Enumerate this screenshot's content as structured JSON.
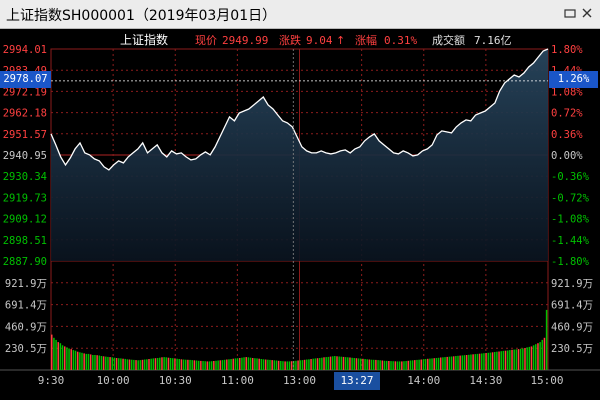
{
  "window": {
    "title": "上证指数SH000001（2019年03月01日）",
    "minimize_icon": "minimize-icon",
    "close_icon": "close-icon"
  },
  "colors": {
    "background": "#000000",
    "grid": "#8b1c1c",
    "up": "#ff4040",
    "down": "#00c000",
    "neutral": "#c8c8c8",
    "line": "#ffffff",
    "fill_top": "#27455c",
    "badge": "#1a56c8"
  },
  "info_bar": {
    "name": "上证指数",
    "price_label": "现价",
    "price": "2949.99",
    "change_label": "涨跌",
    "change": "9.04",
    "change_arrow": "↑",
    "pct_label": "涨幅",
    "pct": "0.31%",
    "turnover_label": "成交额",
    "turnover": "7.16亿"
  },
  "cursor": {
    "price": "2978.07",
    "pct": "1.26%",
    "time": "13:27"
  },
  "chart_data": {
    "type": "line",
    "prev_close": 2940.95,
    "ylim": [
      2887.9,
      2994.01
    ],
    "y_ticks_left": [
      "2994.01",
      "2983.49",
      "2972.19",
      "2962.18",
      "2951.57",
      "2940.95",
      "2930.34",
      "2919.73",
      "2909.12",
      "2898.51",
      "2887.90"
    ],
    "y_ticks_right": [
      "1.80%",
      "1.44%",
      "1.08%",
      "0.72%",
      "0.36%",
      "0.00%",
      "-0.36%",
      "-0.72%",
      "-1.08%",
      "-1.44%",
      "-1.80%"
    ],
    "x_ticks": [
      "9:30",
      "10:00",
      "10:30",
      "11:00",
      "13:00",
      "13:30",
      "14:00",
      "14:30",
      "15:00"
    ],
    "volume_ticks": [
      "921.9万",
      "691.4万",
      "460.9万",
      "230.5万"
    ],
    "volume_max": 921.9,
    "price_points": [
      [
        0,
        2951.5
      ],
      [
        3,
        2946
      ],
      [
        6,
        2940
      ],
      [
        9,
        2936
      ],
      [
        12,
        2939.5
      ],
      [
        15,
        2944
      ],
      [
        18,
        2947
      ],
      [
        21,
        2942
      ],
      [
        24,
        2941
      ],
      [
        27,
        2939
      ],
      [
        30,
        2938
      ],
      [
        33,
        2935
      ],
      [
        36,
        2933.5
      ],
      [
        39,
        2936
      ],
      [
        42,
        2938
      ],
      [
        45,
        2937
      ],
      [
        48,
        2940
      ],
      [
        51,
        2942
      ],
      [
        54,
        2944
      ],
      [
        57,
        2947
      ],
      [
        60,
        2942
      ],
      [
        63,
        2944
      ],
      [
        66,
        2946
      ],
      [
        69,
        2942
      ],
      [
        72,
        2940
      ],
      [
        75,
        2943
      ],
      [
        78,
        2941.5
      ],
      [
        81,
        2942
      ],
      [
        84,
        2940
      ],
      [
        87,
        2938.5
      ],
      [
        90,
        2939
      ],
      [
        93,
        2941
      ],
      [
        96,
        2942.5
      ],
      [
        99,
        2941
      ],
      [
        102,
        2945
      ],
      [
        105,
        2950
      ],
      [
        108,
        2955
      ],
      [
        111,
        2960
      ],
      [
        114,
        2958
      ],
      [
        117,
        2962
      ],
      [
        120,
        2963
      ],
      [
        123,
        2964
      ],
      [
        126,
        2966
      ],
      [
        129,
        2968
      ],
      [
        132,
        2970
      ],
      [
        135,
        2966
      ],
      [
        138,
        2964
      ],
      [
        141,
        2961
      ],
      [
        144,
        2958
      ],
      [
        147,
        2957
      ],
      [
        150,
        2955
      ],
      [
        153,
        2950
      ],
      [
        156,
        2945
      ],
      [
        159,
        2943
      ],
      [
        162,
        2942
      ],
      [
        165,
        2942
      ],
      [
        168,
        2943
      ],
      [
        171,
        2942
      ],
      [
        174,
        2941.5
      ],
      [
        177,
        2942
      ],
      [
        180,
        2943
      ],
      [
        183,
        2943.5
      ],
      [
        186,
        2942
      ],
      [
        189,
        2944
      ],
      [
        192,
        2945
      ],
      [
        195,
        2948
      ],
      [
        198,
        2950
      ],
      [
        201,
        2951.5
      ],
      [
        204,
        2948
      ],
      [
        207,
        2946
      ],
      [
        210,
        2944
      ],
      [
        213,
        2942
      ],
      [
        216,
        2941.5
      ],
      [
        219,
        2943
      ],
      [
        222,
        2942
      ],
      [
        225,
        2940.5
      ],
      [
        228,
        2941
      ],
      [
        231,
        2943
      ],
      [
        234,
        2944
      ],
      [
        237,
        2946
      ],
      [
        240,
        2951
      ],
      [
        243,
        2953
      ],
      [
        246,
        2952.5
      ],
      [
        249,
        2952
      ],
      [
        252,
        2955
      ],
      [
        255,
        2957
      ],
      [
        258,
        2958.5
      ],
      [
        261,
        2958
      ],
      [
        264,
        2961
      ],
      [
        267,
        2962
      ],
      [
        270,
        2963
      ],
      [
        273,
        2965
      ],
      [
        276,
        2967
      ],
      [
        279,
        2973
      ],
      [
        282,
        2977
      ],
      [
        285,
        2979
      ],
      [
        288,
        2981
      ],
      [
        291,
        2980
      ],
      [
        294,
        2982
      ],
      [
        297,
        2985
      ],
      [
        300,
        2987
      ],
      [
        303,
        2990
      ],
      [
        306,
        2993
      ],
      [
        309,
        2994
      ]
    ],
    "volumes": [
      330,
      300,
      280,
      260,
      250,
      230,
      220,
      210,
      200,
      195,
      185,
      180,
      170,
      165,
      160,
      155,
      150,
      150,
      145,
      140,
      140,
      138,
      135,
      130,
      128,
      125,
      122,
      120,
      118,
      115,
      112,
      110,
      108,
      105,
      103,
      100,
      98,
      96,
      94,
      92,
      90,
      92,
      95,
      98,
      100,
      102,
      105,
      108,
      110,
      112,
      115,
      118,
      120,
      118,
      115,
      112,
      110,
      108,
      105,
      102,
      100,
      98,
      96,
      95,
      94,
      92,
      90,
      88,
      86,
      85,
      84,
      82,
      80,
      80,
      82,
      84,
      86,
      88,
      90,
      92,
      95,
      98,
      100,
      102,
      105,
      108,
      110,
      112,
      115,
      118,
      120,
      118,
      115,
      112,
      110,
      108,
      105,
      102,
      100,
      98,
      96,
      94,
      92,
      90,
      88,
      86,
      84,
      82,
      80,
      80,
      80,
      82,
      84,
      86,
      88,
      90,
      92,
      95,
      98,
      100,
      102,
      105,
      108,
      110,
      112,
      115,
      118,
      120,
      122,
      125,
      128,
      130,
      128,
      126,
      124,
      122,
      120,
      118,
      116,
      114,
      112,
      110,
      108,
      106,
      104,
      102,
      100,
      98,
      96,
      95,
      94,
      92,
      90,
      88,
      86,
      85,
      84,
      83,
      82,
      81,
      80,
      80,
      80,
      82,
      84,
      86,
      88,
      90,
      92,
      94,
      96,
      98,
      100,
      102,
      104,
      106,
      108,
      110,
      112,
      114,
      116,
      118,
      120,
      122,
      124,
      126,
      128,
      130,
      132,
      134,
      136,
      138,
      140,
      142,
      144,
      146,
      148,
      150,
      152,
      154,
      156,
      158,
      160,
      162,
      165,
      168,
      170,
      172,
      175,
      178,
      180,
      182,
      185,
      188,
      190,
      192,
      195,
      198,
      200,
      205,
      210,
      215,
      220,
      230,
      240,
      250,
      260,
      280,
      300,
      560
    ]
  }
}
